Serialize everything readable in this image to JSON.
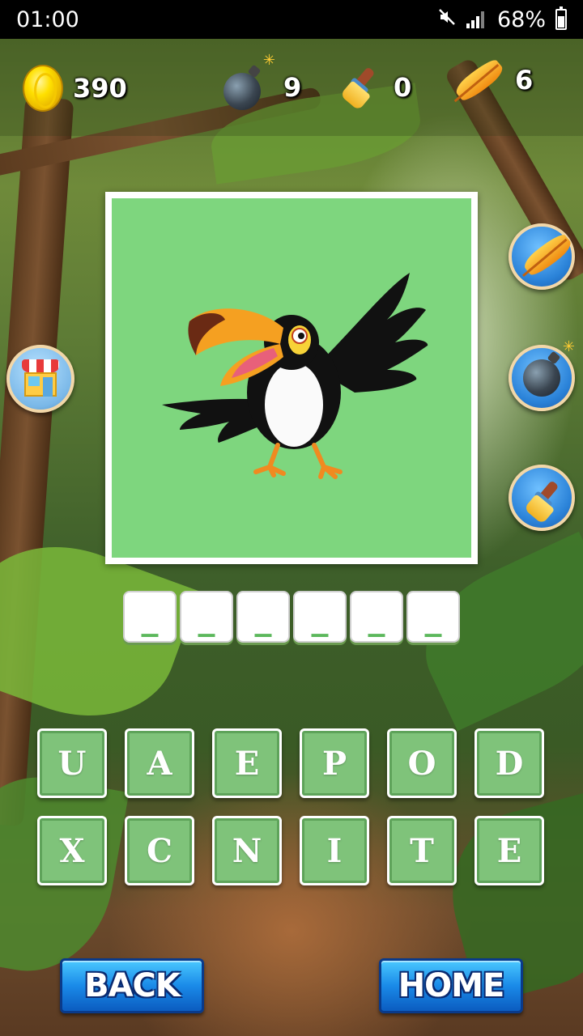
{
  "status_bar": {
    "time": "01:00",
    "battery": "68%"
  },
  "resources": {
    "coins": "390",
    "bombs": "9",
    "brushes": "0",
    "feathers": "6"
  },
  "answer_slots": [
    "_",
    "_",
    "_",
    "_",
    "_",
    "_"
  ],
  "letters": {
    "row1": [
      "U",
      "A",
      "E",
      "P",
      "O",
      "D"
    ],
    "row2": [
      "X",
      "C",
      "N",
      "I",
      "T",
      "E"
    ]
  },
  "buttons": {
    "back": "BACK",
    "home": "HOME"
  },
  "colors": {
    "tile_green": "#7fc37a",
    "picture_bg": "#7ed67e",
    "button_blue": "#1a8ae8"
  }
}
